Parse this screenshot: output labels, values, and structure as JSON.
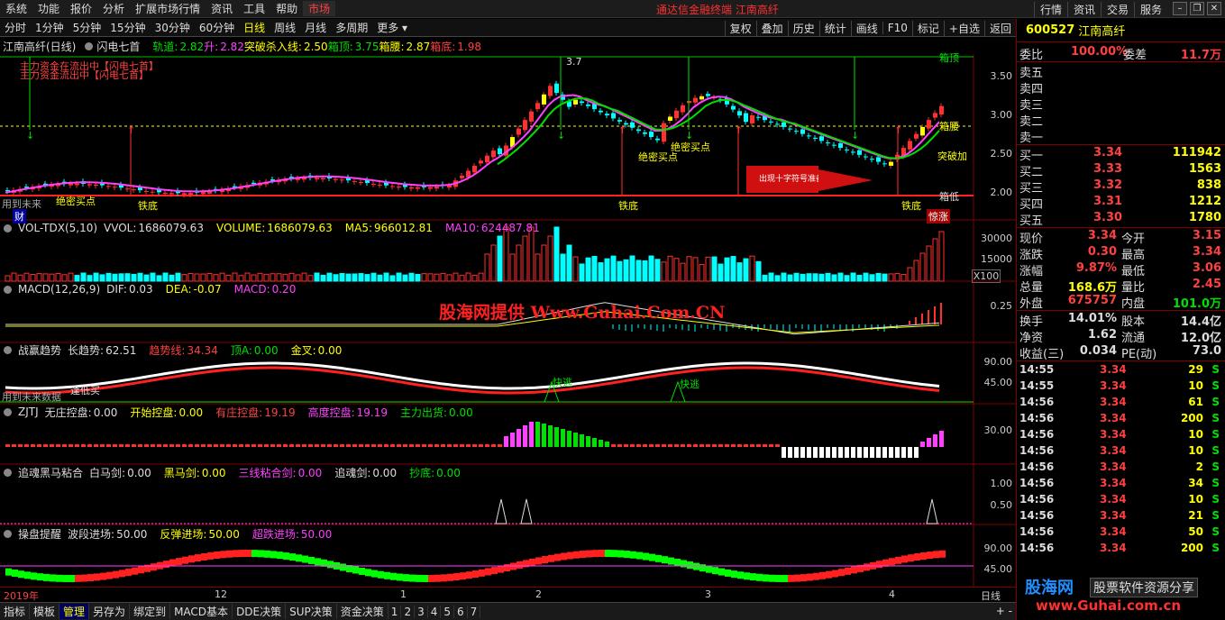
{
  "menu": {
    "items": [
      "系统",
      "功能",
      "报价",
      "分析",
      "扩展市场行情",
      "资讯",
      "工具",
      "帮助"
    ],
    "market": "市场",
    "center_title": "通达信金融终端  江南高纤",
    "right": [
      "行情",
      "资讯",
      "交易",
      "服务"
    ]
  },
  "period": {
    "items": [
      "分时",
      "1分钟",
      "5分钟",
      "15分钟",
      "30分钟",
      "60分钟",
      "日线",
      "周线",
      "月线",
      "多周期",
      "更多"
    ],
    "active": "日线",
    "tools": [
      "复权",
      "叠加",
      "历史",
      "统计",
      "画线",
      "F10",
      "标记",
      "+自选",
      "返回"
    ]
  },
  "main_chart": {
    "name": "江南高纤(日线)",
    "indicator": "闪电七首",
    "params": [
      {
        "label": "轨道:",
        "value": "2.82",
        "color": "#00e000"
      },
      {
        "label": "升:",
        "value": "2.82",
        "color": "#ff40ff"
      },
      {
        "label": "突破杀入线:",
        "value": "2.50",
        "color": "#ffff00"
      },
      {
        "label": "箱顶:",
        "value": "3.75",
        "color": "#00e000"
      },
      {
        "label": "箱腰:",
        "value": "2.87",
        "color": "#ffff00"
      },
      {
        "label": "箱底:",
        "value": "1.98",
        "color": "#ff4040"
      }
    ],
    "y_ticks": [
      "3.50",
      "3.00",
      "2.50",
      "2.00"
    ],
    "right_labels": [
      "箱顶",
      "箱腰",
      "突破加",
      "箱低"
    ],
    "annotations": {
      "red_text_1": "主力资金在流出中【闪电七首】",
      "red_text_2": "主力资金流出中【闪电七首】",
      "future": "用到未来",
      "cai": "财",
      "jinglin": "惊涨",
      "cross_note": "出现十字符号准备买",
      "jueshi": "绝密买点",
      "tiedi": "铁底",
      "chu": "出",
      "mai": "买",
      "peak": "3.7"
    }
  },
  "vol": {
    "title": "VOL-TDX(5,10)",
    "items": [
      {
        "label": "VVOL:",
        "value": "1686079.63",
        "color": "#ddd"
      },
      {
        "label": "VOLUME:",
        "value": "1686079.63",
        "color": "#ffff00"
      },
      {
        "label": "MA5:",
        "value": "966012.81",
        "color": "#ffff00"
      },
      {
        "label": "MA10:",
        "value": "624487.81",
        "color": "#ff40ff"
      }
    ],
    "y_ticks": [
      "30000",
      "15000",
      "X100"
    ]
  },
  "macd": {
    "title": "MACD(12,26,9)",
    "items": [
      {
        "label": "DIF:",
        "value": "0.03",
        "color": "#ddd"
      },
      {
        "label": "DEA:",
        "value": "-0.07",
        "color": "#ffff00"
      },
      {
        "label": "MACD:",
        "value": "0.20",
        "color": "#ff40ff"
      }
    ],
    "y_ticks": [
      "0.25"
    ]
  },
  "zhanyin": {
    "title": "战赢趋势",
    "items": [
      {
        "label": "长趋势:",
        "value": "62.51",
        "color": "#ddd"
      },
      {
        "label": "趋势线:",
        "value": "34.34",
        "color": "#ff4040"
      },
      {
        "label": "顶A:",
        "value": "0.00",
        "color": "#00e000"
      },
      {
        "label": "金叉:",
        "value": "0.00",
        "color": "#ffff00"
      }
    ],
    "y_ticks": [
      "90.00",
      "45.00"
    ],
    "ann": {
      "low": "逢低买",
      "future": "用到未来数据",
      "kuaitao1": "快逃",
      "kuaitao2": "快逃"
    }
  },
  "zjtj": {
    "title": "ZJTJ",
    "items": [
      {
        "label": "无庄控盘:",
        "value": "0.00",
        "color": "#ddd"
      },
      {
        "label": "开始控盘:",
        "value": "0.00",
        "color": "#ffff00"
      },
      {
        "label": "有庄控盘:",
        "value": "19.19",
        "color": "#ff4040"
      },
      {
        "label": "高度控盘:",
        "value": "19.19",
        "color": "#ff40ff"
      },
      {
        "label": "主力出货:",
        "value": "0.00",
        "color": "#00e000"
      }
    ],
    "y_ticks": [
      "30.00"
    ]
  },
  "zhuihun": {
    "title": "追魂黑马粘合",
    "items": [
      {
        "label": "白马剑:",
        "value": "0.00",
        "color": "#ddd"
      },
      {
        "label": "黑马剑:",
        "value": "0.00",
        "color": "#ffff00"
      },
      {
        "label": "三线粘合剑:",
        "value": "0.00",
        "color": "#ff40ff"
      },
      {
        "label": "追魂剑:",
        "value": "0.00",
        "color": "#ddd"
      },
      {
        "label": "抄底:",
        "value": "0.00",
        "color": "#00e000"
      }
    ],
    "y_ticks": [
      "1.00",
      "0.50"
    ]
  },
  "caopan": {
    "title": "操盘提醒",
    "items": [
      {
        "label": "波段进场:",
        "value": "50.00",
        "color": "#ddd"
      },
      {
        "label": "反弹进场:",
        "value": "50.00",
        "color": "#ffff00"
      },
      {
        "label": "超跌进场:",
        "value": "50.00",
        "color": "#ff40ff"
      }
    ],
    "y_ticks": [
      "90.00",
      "45.00"
    ]
  },
  "xaxis": {
    "labels": [
      "2019年",
      "12",
      "1",
      "2",
      "3",
      "4"
    ],
    "right": "日线"
  },
  "bottom": {
    "items": [
      "指标",
      "模板",
      "管理",
      "另存为",
      "绑定到",
      "MACD基本",
      "DDE决策",
      "SUP决策",
      "资金决策"
    ],
    "active": "管理",
    "nums": [
      "1",
      "2",
      "3",
      "4",
      "5",
      "6",
      "7"
    ],
    "arrows": "+ -"
  },
  "watermark": "股海网提供 Www.Guhai.Com.CN",
  "quote": {
    "code": "600527",
    "name": "江南高纤",
    "weibi_label": "委比",
    "weibi": "100.00%",
    "weicha_label": "委差",
    "weicha": "11.7万",
    "sell": [
      "卖五",
      "卖四",
      "卖三",
      "卖二",
      "卖一"
    ],
    "buy": [
      {
        "label": "买一",
        "price": "3.34",
        "vol": "111942"
      },
      {
        "label": "买二",
        "price": "3.33",
        "vol": "1563"
      },
      {
        "label": "买三",
        "price": "3.32",
        "vol": "838"
      },
      {
        "label": "买四",
        "price": "3.31",
        "vol": "1212"
      },
      {
        "label": "买五",
        "price": "3.30",
        "vol": "1780"
      }
    ],
    "stats": [
      {
        "l1": "现价",
        "v1": "3.34",
        "c1": "red",
        "l2": "今开",
        "v2": "3.15",
        "c2": "red"
      },
      {
        "l1": "涨跌",
        "v1": "0.30",
        "c1": "red",
        "l2": "最高",
        "v2": "3.34",
        "c2": "red"
      },
      {
        "l1": "涨幅",
        "v1": "9.87%",
        "c1": "red",
        "l2": "最低",
        "v2": "3.06",
        "c2": "red"
      },
      {
        "l1": "总量",
        "v1": "168.6万",
        "c1": "yel",
        "l2": "量比",
        "v2": "2.45",
        "c2": "red"
      },
      {
        "l1": "外盘",
        "v1": "675757",
        "c1": "red",
        "l2": "内盘",
        "v2": "101.0万",
        "c2": "grn"
      }
    ],
    "stats2": [
      {
        "l1": "换手",
        "v1": "14.01%",
        "l2": "股本",
        "v2": "14.4亿"
      },
      {
        "l1": "净资",
        "v1": "1.62",
        "l2": "流通",
        "v2": "12.0亿"
      },
      {
        "l1": "收益(三)",
        "v1": "0.034",
        "l2": "PE(动)",
        "v2": "73.0"
      }
    ],
    "ticks": [
      {
        "t": "14:55",
        "p": "3.34",
        "v": "29",
        "s": "S"
      },
      {
        "t": "14:55",
        "p": "3.34",
        "v": "10",
        "s": "S"
      },
      {
        "t": "14:56",
        "p": "3.34",
        "v": "61",
        "s": "S"
      },
      {
        "t": "14:56",
        "p": "3.34",
        "v": "200",
        "s": "S"
      },
      {
        "t": "14:56",
        "p": "3.34",
        "v": "10",
        "s": "S"
      },
      {
        "t": "14:56",
        "p": "3.34",
        "v": "10",
        "s": "S"
      },
      {
        "t": "14:56",
        "p": "3.34",
        "v": "2",
        "s": "S"
      },
      {
        "t": "14:56",
        "p": "3.34",
        "v": "34",
        "s": "S"
      },
      {
        "t": "14:56",
        "p": "3.34",
        "v": "10",
        "s": "S"
      },
      {
        "t": "14:56",
        "p": "3.34",
        "v": "21",
        "s": "S"
      },
      {
        "t": "14:56",
        "p": "3.34",
        "v": "50",
        "s": "S"
      },
      {
        "t": "14:56",
        "p": "3.34",
        "v": "200",
        "s": "S"
      }
    ]
  },
  "brand": {
    "name": "股海网",
    "slogan": "股票软件资源分享",
    "url": "www.Guhai.com.cn"
  },
  "colors": {
    "up": "#ff4040",
    "down": "#00ffff",
    "bg": "#000000",
    "grid": "#800000"
  }
}
